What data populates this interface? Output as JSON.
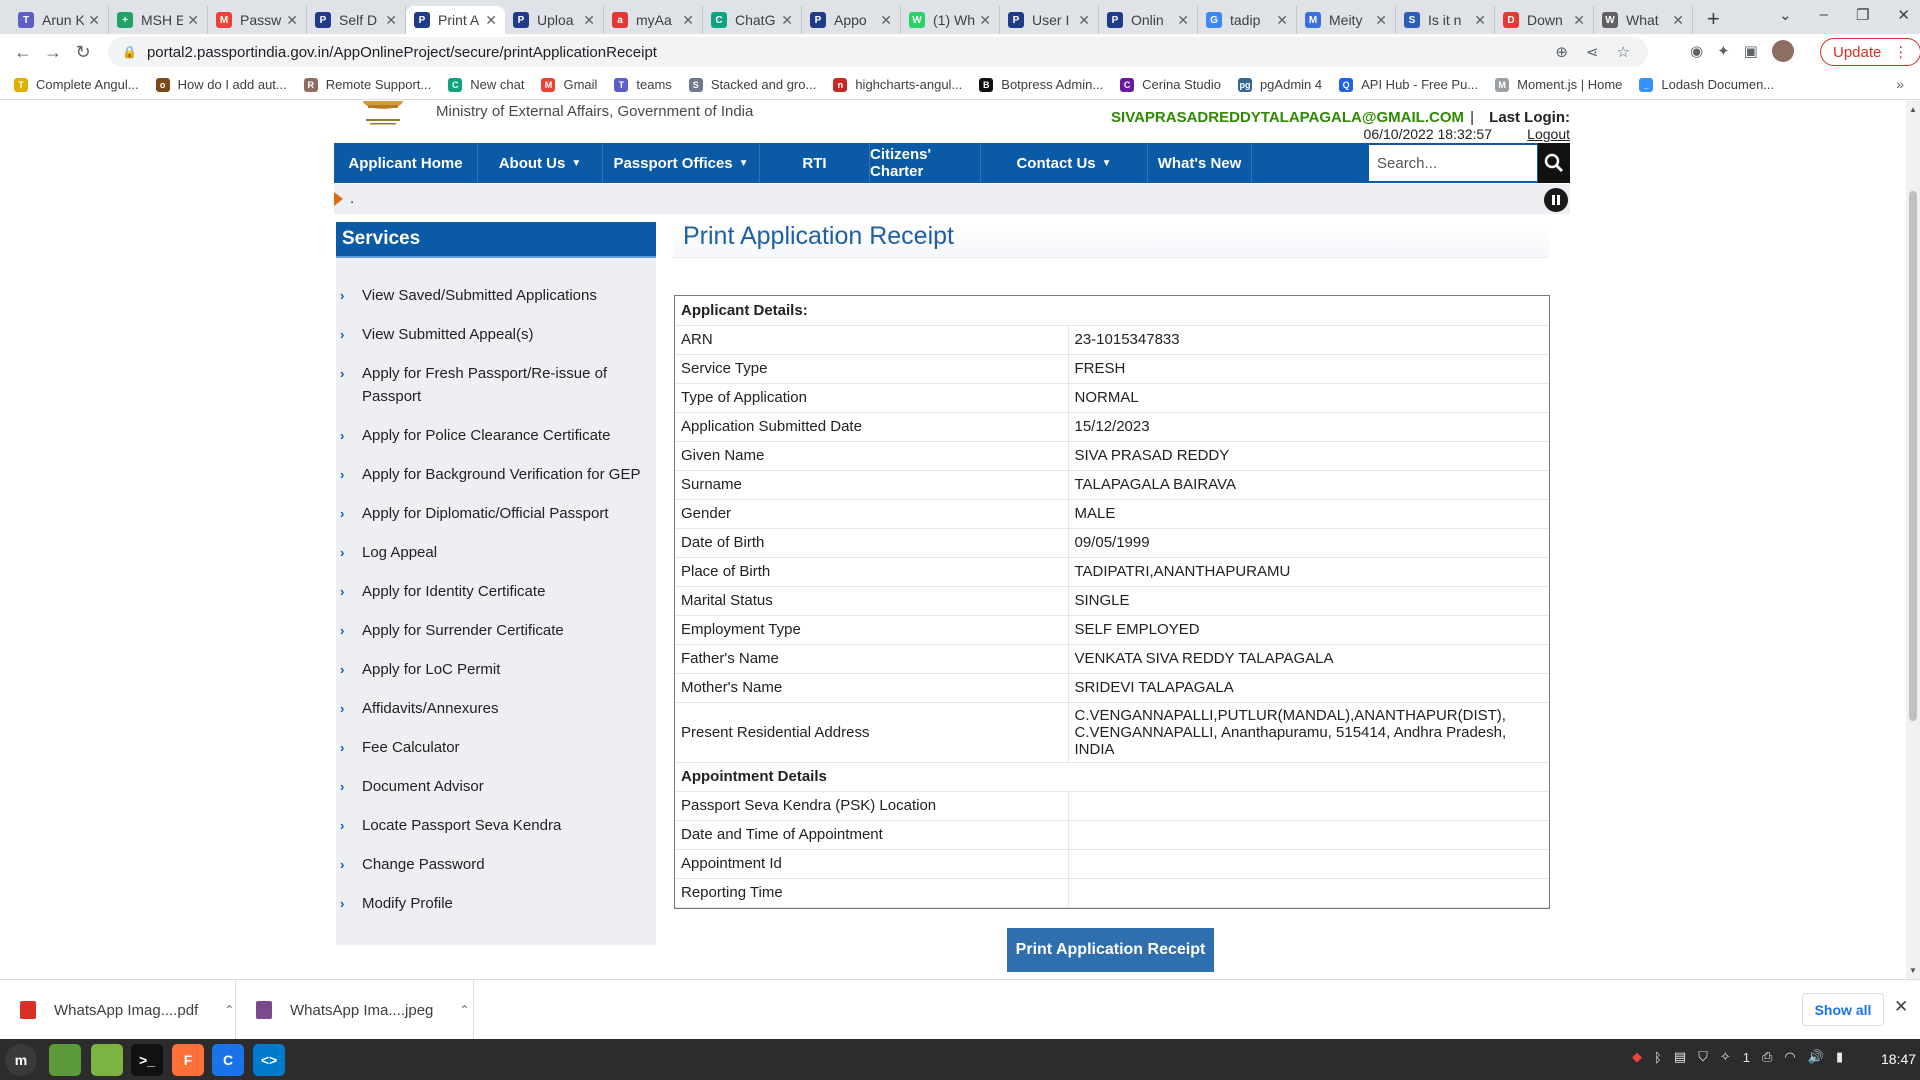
{
  "browser": {
    "tabs": [
      {
        "title": "Arun K",
        "color": "#5b5fc7",
        "glyph": "T"
      },
      {
        "title": "MSH E",
        "color": "#21a366",
        "glyph": "+"
      },
      {
        "title": "Passw",
        "color": "#ea4335",
        "glyph": "M"
      },
      {
        "title": "Self D",
        "color": "#1f3c88",
        "glyph": "P"
      },
      {
        "title": "Print A",
        "color": "#1f3c88",
        "glyph": "P"
      },
      {
        "title": "Uploa",
        "color": "#1f3c88",
        "glyph": "P"
      },
      {
        "title": "myAa",
        "color": "#e53935",
        "glyph": "a"
      },
      {
        "title": "ChatG",
        "color": "#10a37f",
        "glyph": "C"
      },
      {
        "title": "Appo",
        "color": "#1f3c88",
        "glyph": "P"
      },
      {
        "title": "(1) Wh",
        "color": "#25d366",
        "glyph": "W"
      },
      {
        "title": "User I",
        "color": "#1f3c88",
        "glyph": "P"
      },
      {
        "title": "Onlin",
        "color": "#1f3c88",
        "glyph": "P"
      },
      {
        "title": "tadip",
        "color": "#4285f4",
        "glyph": "G"
      },
      {
        "title": "Meity",
        "color": "#3b6fd9",
        "glyph": "M"
      },
      {
        "title": "Is it n",
        "color": "#2d5fb8",
        "glyph": "S"
      },
      {
        "title": "Down",
        "color": "#e53935",
        "glyph": "D"
      },
      {
        "title": "What",
        "color": "#616161",
        "glyph": "W"
      }
    ],
    "active_tab_index": 4,
    "url": "portal2.passportindia.gov.in/AppOnlineProject/secure/printApplicationReceipt",
    "update_label": "Update",
    "bookmarks": [
      {
        "label": "Complete Angul...",
        "color": "#e0b000",
        "glyph": "T"
      },
      {
        "label": "How do I add aut...",
        "color": "#7a4a1c",
        "glyph": "o"
      },
      {
        "label": "Remote Support...",
        "color": "#8d6e63",
        "glyph": "R"
      },
      {
        "label": "New chat",
        "color": "#10a37f",
        "glyph": "C"
      },
      {
        "label": "Gmail",
        "color": "#ea4335",
        "glyph": "M"
      },
      {
        "label": "teams",
        "color": "#5b5fc7",
        "glyph": "T"
      },
      {
        "label": "Stacked and gro...",
        "color": "#6d7b8d",
        "glyph": "S"
      },
      {
        "label": "highcharts-angul...",
        "color": "#c62828",
        "glyph": "n"
      },
      {
        "label": "Botpress Admin...",
        "color": "#111111",
        "glyph": "B"
      },
      {
        "label": "Cerina Studio",
        "color": "#6a1b9a",
        "glyph": "C"
      },
      {
        "label": "pgAdmin 4",
        "color": "#336791",
        "glyph": "pg"
      },
      {
        "label": "API Hub - Free Pu...",
        "color": "#1e63e9",
        "glyph": "Q"
      },
      {
        "label": "Moment.js | Home",
        "color": "#9aa0a6",
        "glyph": "M"
      },
      {
        "label": "Lodash Documen...",
        "color": "#3492ff",
        "glyph": "_"
      }
    ]
  },
  "header": {
    "ministry": "Ministry of External Affairs, Government of India",
    "user_email": "SIVAPRASADREDDYTALAPAGALA@GMAIL.COM",
    "separator": "|",
    "last_login_label": "Last Login:",
    "last_login_time": "06/10/2022 18:32:57",
    "logout_label": "Logout"
  },
  "nav": {
    "items": [
      {
        "label": "Applicant Home",
        "dropdown": false
      },
      {
        "label": "About Us",
        "dropdown": true
      },
      {
        "label": "Passport Offices",
        "dropdown": true
      },
      {
        "label": "RTI",
        "dropdown": false
      },
      {
        "label": "Citizens' Charter",
        "dropdown": false
      },
      {
        "label": "Contact Us",
        "dropdown": true
      },
      {
        "label": "What's New",
        "dropdown": false
      }
    ],
    "search_placeholder": "Search..."
  },
  "ticker": {
    "text": "."
  },
  "sidebar": {
    "title": "Services",
    "items": [
      "View Saved/Submitted Applications",
      "View Submitted Appeal(s)",
      "Apply for Fresh Passport/Re-issue of Passport",
      "Apply for Police Clearance Certificate",
      "Apply for Background Verification for GEP",
      "Apply for Diplomatic/Official Passport",
      "Log Appeal",
      "Apply for Identity Certificate",
      "Apply for Surrender Certificate",
      "Apply for LoC Permit",
      "Affidavits/Annexures",
      "Fee Calculator",
      "Document Advisor",
      "Locate Passport Seva Kendra",
      "Change Password",
      "Modify Profile"
    ]
  },
  "content": {
    "title": "Print Application Receipt",
    "applicant_section": "Applicant Details:",
    "applicant_rows": [
      {
        "label": "ARN",
        "value": "23-1015347833"
      },
      {
        "label": "Service Type",
        "value": "FRESH"
      },
      {
        "label": "Type of Application",
        "value": "NORMAL"
      },
      {
        "label": "Application Submitted Date",
        "value": "15/12/2023"
      },
      {
        "label": "Given Name",
        "value": "SIVA PRASAD REDDY"
      },
      {
        "label": "Surname",
        "value": "TALAPAGALA BAIRAVA"
      },
      {
        "label": "Gender",
        "value": "MALE"
      },
      {
        "label": "Date of Birth",
        "value": "09/05/1999"
      },
      {
        "label": "Place of Birth",
        "value": "TADIPATRI,ANANTHAPURAMU"
      },
      {
        "label": "Marital Status",
        "value": "SINGLE"
      },
      {
        "label": "Employment Type",
        "value": "SELF EMPLOYED"
      },
      {
        "label": "Father's Name",
        "value": "VENKATA SIVA REDDY TALAPAGALA"
      },
      {
        "label": "Mother's Name",
        "value": "SRIDEVI TALAPAGALA"
      }
    ],
    "address_label": "Present Residential Address",
    "address_lines": [
      "C.VENGANNAPALLI,PUTLUR(MANDAL),ANANTHAPUR(DIST),",
      "C.VENGANNAPALLI, Ananthapuramu, 515414, Andhra Pradesh,",
      "INDIA"
    ],
    "appointment_section": "Appointment Details",
    "appointment_rows": [
      {
        "label": "Passport Seva Kendra (PSK) Location",
        "value": ""
      },
      {
        "label": "Date and Time of Appointment",
        "value": ""
      },
      {
        "label": "Appointment Id",
        "value": ""
      },
      {
        "label": "Reporting Time",
        "value": ""
      }
    ],
    "print_button": "Print Application Receipt"
  },
  "downloads": {
    "items": [
      {
        "name": "WhatsApp Imag....pdf",
        "color": "#d93025"
      },
      {
        "name": "WhatsApp Ima....jpeg",
        "color": "#7a4a8a"
      }
    ],
    "show_all": "Show all"
  },
  "taskbar": {
    "apps": [
      {
        "name": "menu",
        "color": "#3a3a3a",
        "glyph": "m"
      },
      {
        "name": "files-green",
        "color": "#5a9a3a",
        "glyph": ""
      },
      {
        "name": "folder",
        "color": "#7cb342",
        "glyph": ""
      },
      {
        "name": "terminal",
        "color": "#111111",
        "glyph": ">_"
      },
      {
        "name": "firefox",
        "color": "#ff7139",
        "glyph": "F"
      },
      {
        "name": "chrome",
        "color": "#1a73e8",
        "glyph": "C"
      },
      {
        "name": "vscode",
        "color": "#007acc",
        "glyph": "<>"
      }
    ],
    "tray_count": "1",
    "clock": "18:47"
  }
}
